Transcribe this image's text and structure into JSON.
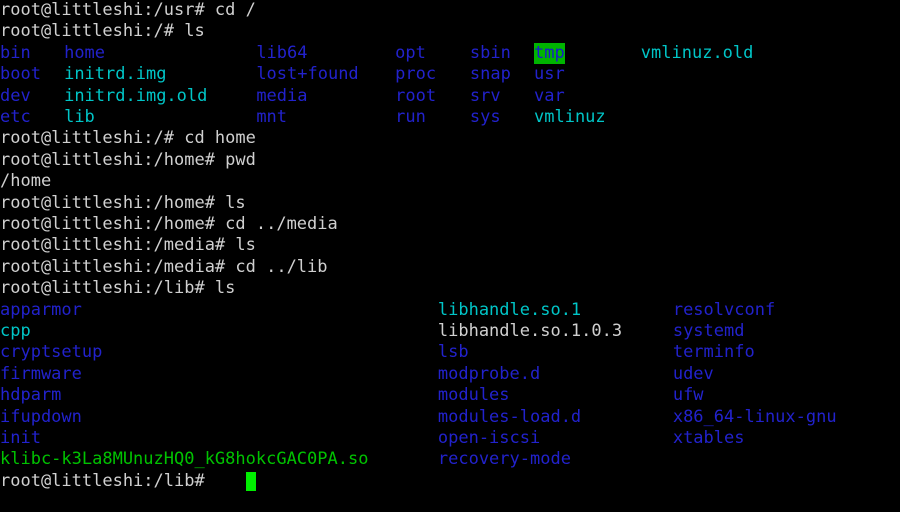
{
  "terminal": {
    "title": "root@littleshi: /lib",
    "hostname": "littleshi",
    "user": "root",
    "background_color": "#000000",
    "foreground_color": "#d0d0d0",
    "colors": {
      "white": "#d0d0d0",
      "blue": "#2222cc",
      "cyan": "#00c5c7",
      "green": "#00c200",
      "cursor": "#00ee00",
      "sticky_dir_bg": "#00b400"
    },
    "char_width": 10.68,
    "line_height": 21.4,
    "cursor": {
      "visible": true,
      "column": 23,
      "line": 22,
      "style": "block"
    }
  },
  "lines": [
    {
      "id": "l0",
      "cells": [
        {
          "col": 0,
          "text": "root@littleshi:/usr# cd /",
          "color": "white"
        }
      ]
    },
    {
      "id": "l1",
      "cells": [
        {
          "col": 0,
          "text": "root@littleshi:/# ls",
          "color": "white"
        }
      ]
    },
    {
      "id": "l2",
      "cells": [
        {
          "col": 0,
          "text": "bin",
          "color": "blue"
        },
        {
          "col": 6,
          "text": "home",
          "color": "blue"
        },
        {
          "col": 24,
          "text": "lib64",
          "color": "blue"
        },
        {
          "col": 37,
          "text": "opt",
          "color": "blue"
        },
        {
          "col": 44,
          "text": "sbin",
          "color": "blue"
        },
        {
          "col": 50,
          "text": "tmp",
          "color": "tmp"
        },
        {
          "col": 60,
          "text": "vmlinuz.old",
          "color": "cyan"
        }
      ]
    },
    {
      "id": "l3",
      "cells": [
        {
          "col": 0,
          "text": "boot",
          "color": "blue"
        },
        {
          "col": 6,
          "text": "initrd.img",
          "color": "cyan"
        },
        {
          "col": 24,
          "text": "lost+found",
          "color": "blue"
        },
        {
          "col": 37,
          "text": "proc",
          "color": "blue"
        },
        {
          "col": 44,
          "text": "snap",
          "color": "blue"
        },
        {
          "col": 50,
          "text": "usr",
          "color": "blue"
        }
      ]
    },
    {
      "id": "l4",
      "cells": [
        {
          "col": 0,
          "text": "dev",
          "color": "blue"
        },
        {
          "col": 6,
          "text": "initrd.img.old",
          "color": "cyan"
        },
        {
          "col": 24,
          "text": "media",
          "color": "blue"
        },
        {
          "col": 37,
          "text": "root",
          "color": "blue"
        },
        {
          "col": 44,
          "text": "srv",
          "color": "blue"
        },
        {
          "col": 50,
          "text": "var",
          "color": "blue"
        }
      ]
    },
    {
      "id": "l5",
      "cells": [
        {
          "col": 0,
          "text": "etc",
          "color": "blue"
        },
        {
          "col": 6,
          "text": "lib",
          "color": "cyan"
        },
        {
          "col": 24,
          "text": "mnt",
          "color": "blue"
        },
        {
          "col": 37,
          "text": "run",
          "color": "blue"
        },
        {
          "col": 44,
          "text": "sys",
          "color": "blue"
        },
        {
          "col": 50,
          "text": "vmlinuz",
          "color": "cyan"
        }
      ]
    },
    {
      "id": "l6",
      "cells": [
        {
          "col": 0,
          "text": "root@littleshi:/# cd home",
          "color": "white"
        }
      ]
    },
    {
      "id": "l7",
      "cells": [
        {
          "col": 0,
          "text": "root@littleshi:/home# pwd",
          "color": "white"
        }
      ]
    },
    {
      "id": "l8",
      "cells": [
        {
          "col": 0,
          "text": "/home",
          "color": "white"
        }
      ]
    },
    {
      "id": "l9",
      "cells": [
        {
          "col": 0,
          "text": "root@littleshi:/home# ls",
          "color": "white"
        }
      ]
    },
    {
      "id": "l10",
      "cells": [
        {
          "col": 0,
          "text": "root@littleshi:/home# cd ../media",
          "color": "white"
        }
      ]
    },
    {
      "id": "l11",
      "cells": [
        {
          "col": 0,
          "text": "root@littleshi:/media# ls",
          "color": "white"
        }
      ]
    },
    {
      "id": "l12",
      "cells": [
        {
          "col": 0,
          "text": "root@littleshi:/media# cd ../lib",
          "color": "white"
        }
      ]
    },
    {
      "id": "l13",
      "cells": [
        {
          "col": 0,
          "text": "root@littleshi:/lib# ls",
          "color": "white"
        }
      ]
    },
    {
      "id": "l14",
      "cells": [
        {
          "col": 0,
          "text": "apparmor",
          "color": "blue"
        },
        {
          "col": 41,
          "text": "libhandle.so.1",
          "color": "cyan"
        },
        {
          "col": 63,
          "text": "resolvconf",
          "color": "blue"
        }
      ]
    },
    {
      "id": "l15",
      "cells": [
        {
          "col": 0,
          "text": "cpp",
          "color": "cyan"
        },
        {
          "col": 41,
          "text": "libhandle.so.1.0.3",
          "color": "white"
        },
        {
          "col": 63,
          "text": "systemd",
          "color": "blue"
        }
      ]
    },
    {
      "id": "l16",
      "cells": [
        {
          "col": 0,
          "text": "cryptsetup",
          "color": "blue"
        },
        {
          "col": 41,
          "text": "lsb",
          "color": "blue"
        },
        {
          "col": 63,
          "text": "terminfo",
          "color": "blue"
        }
      ]
    },
    {
      "id": "l17",
      "cells": [
        {
          "col": 0,
          "text": "firmware",
          "color": "blue"
        },
        {
          "col": 41,
          "text": "modprobe.d",
          "color": "blue"
        },
        {
          "col": 63,
          "text": "udev",
          "color": "blue"
        }
      ]
    },
    {
      "id": "l18",
      "cells": [
        {
          "col": 0,
          "text": "hdparm",
          "color": "blue"
        },
        {
          "col": 41,
          "text": "modules",
          "color": "blue"
        },
        {
          "col": 63,
          "text": "ufw",
          "color": "blue"
        }
      ]
    },
    {
      "id": "l19",
      "cells": [
        {
          "col": 0,
          "text": "ifupdown",
          "color": "blue"
        },
        {
          "col": 41,
          "text": "modules-load.d",
          "color": "blue"
        },
        {
          "col": 63,
          "text": "x86_64-linux-gnu",
          "color": "blue"
        }
      ]
    },
    {
      "id": "l20",
      "cells": [
        {
          "col": 0,
          "text": "init",
          "color": "blue"
        },
        {
          "col": 41,
          "text": "open-iscsi",
          "color": "blue"
        },
        {
          "col": 63,
          "text": "xtables",
          "color": "blue"
        }
      ]
    },
    {
      "id": "l21",
      "cells": [
        {
          "col": 0,
          "text": "klibc-k3La8MUnuzHQ0_kG8hokcGAC0PA.so",
          "color": "green"
        },
        {
          "col": 41,
          "text": "recovery-mode",
          "color": "blue"
        }
      ]
    },
    {
      "id": "l22",
      "cells": [
        {
          "col": 0,
          "text": "root@littleshi:/lib# ",
          "color": "white"
        }
      ]
    }
  ]
}
